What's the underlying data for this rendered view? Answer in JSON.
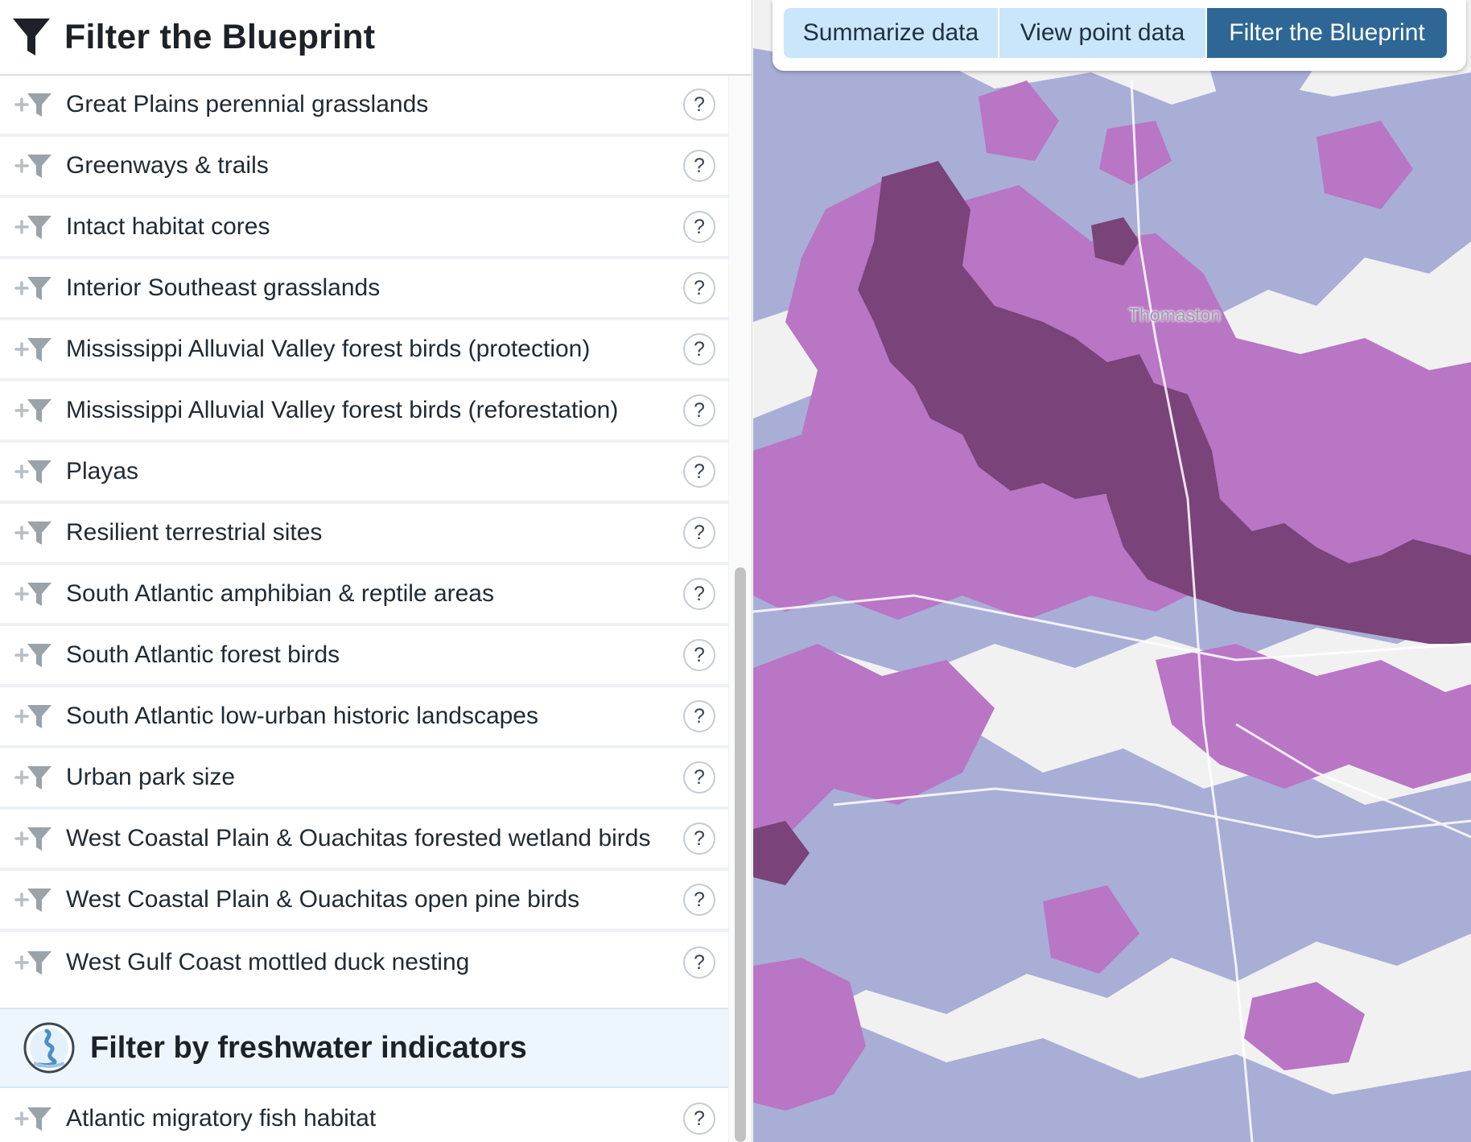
{
  "sidebar": {
    "title": "Filter the Blueprint",
    "title_icon": "funnel-icon",
    "indicators": [
      {
        "label": "Great Plains perennial grasslands",
        "help": "?"
      },
      {
        "label": "Greenways & trails",
        "help": "?"
      },
      {
        "label": "Intact habitat cores",
        "help": "?"
      },
      {
        "label": "Interior Southeast grasslands",
        "help": "?"
      },
      {
        "label": "Mississippi Alluvial Valley forest birds (protection)",
        "help": "?"
      },
      {
        "label": "Mississippi Alluvial Valley forest birds (reforestation)",
        "help": "?"
      },
      {
        "label": "Playas",
        "help": "?"
      },
      {
        "label": "Resilient terrestrial sites",
        "help": "?"
      },
      {
        "label": "South Atlantic amphibian & reptile areas",
        "help": "?"
      },
      {
        "label": "South Atlantic forest birds",
        "help": "?"
      },
      {
        "label": "South Atlantic low-urban historic landscapes",
        "help": "?"
      },
      {
        "label": "Urban park size",
        "help": "?"
      },
      {
        "label": "West Coastal Plain & Ouachitas forested wetland birds",
        "help": "?"
      },
      {
        "label": "West Coastal Plain & Ouachitas open pine birds",
        "help": "?"
      },
      {
        "label": "West Gulf Coast mottled duck nesting",
        "help": "?"
      }
    ],
    "freshwater_section": {
      "title": "Filter by freshwater indicators",
      "icon": "freshwater-icon",
      "indicators": [
        {
          "label": "Atlantic migratory fish habitat",
          "help": "?"
        }
      ]
    }
  },
  "map": {
    "place_label": "Thomaston",
    "tabs": [
      {
        "label": "Summarize data",
        "active": false
      },
      {
        "label": "View point data",
        "active": false
      },
      {
        "label": "Filter the Blueprint",
        "active": true
      }
    ],
    "colors": {
      "background": "#f1f1f1",
      "low_priority": "#a9aed6",
      "medium_priority": "#b876c4",
      "high_priority": "#7a4379",
      "active_tab": "#2e6796",
      "inactive_tab": "#c9e6fb"
    }
  }
}
